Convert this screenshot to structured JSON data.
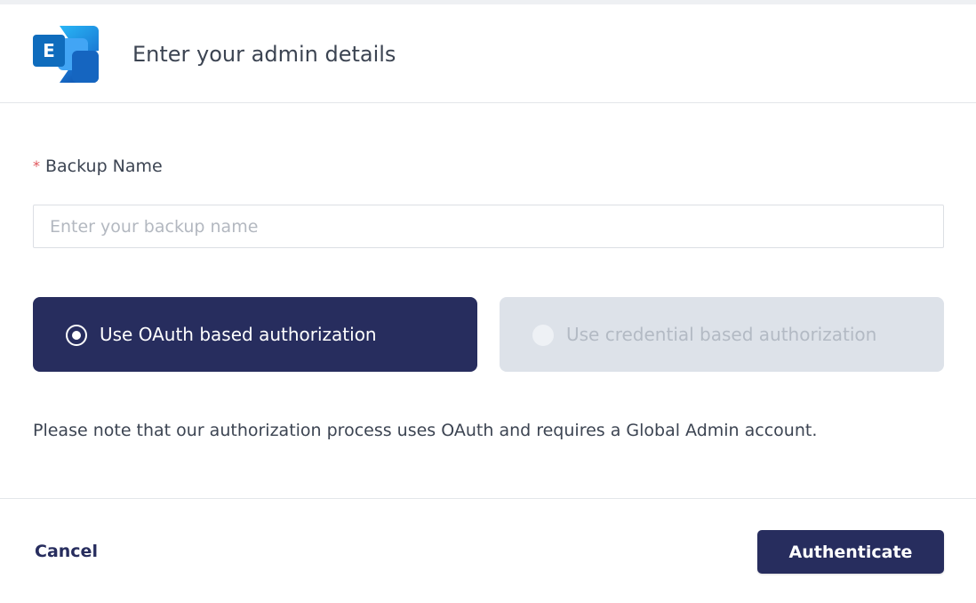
{
  "header": {
    "logo_icon": "exchange-logo-icon",
    "logo_letter": "E",
    "title": "Enter your admin details"
  },
  "form": {
    "required_mark": "*",
    "backup_name_label": "Backup Name",
    "backup_name_placeholder": "Enter your backup name",
    "backup_name_value": ""
  },
  "auth_options": [
    {
      "label": "Use OAuth based authorization",
      "selected": true
    },
    {
      "label": "Use credential based authorization",
      "selected": false
    }
  ],
  "note": "Please note that our authorization process uses OAuth and requires a Global Admin account.",
  "footer": {
    "cancel_label": "Cancel",
    "authenticate_label": "Authenticate"
  },
  "colors": {
    "primary": "#272d5e",
    "disabled_option": "#dde2e9",
    "required": "#e0555b",
    "logo_dark": "#1e6fc9",
    "logo_light": "#4fc3f7"
  }
}
